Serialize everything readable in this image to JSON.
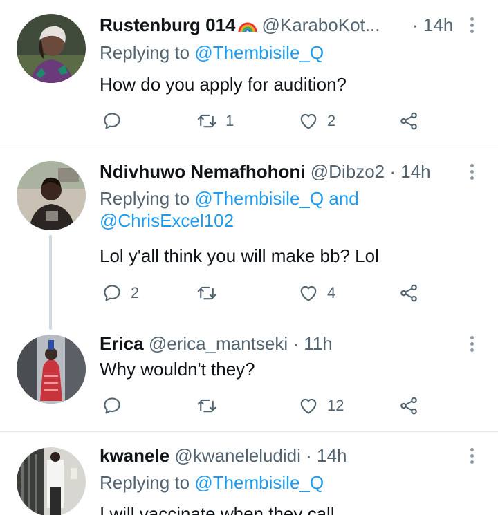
{
  "tweets": [
    {
      "name": "Rustenburg 014",
      "emoji": "rainbow-emoji",
      "handle": "@KaraboKot...",
      "sep": "·",
      "time": "14h",
      "replying_prefix": "Replying to ",
      "replying_to": "@Thembisile_Q",
      "replying_and": "",
      "replying_to2": "",
      "text": "How do you apply for audition?",
      "reply_count": "",
      "retweet_count": "1",
      "like_count": "2"
    },
    {
      "name": "Ndivhuwo Nemafhohoni",
      "handle": "@Dibzo2",
      "sep": "·",
      "time": "14h",
      "replying_prefix": "Replying to ",
      "replying_to": "@Thembisile_Q",
      "replying_and": " and",
      "replying_to2": "@ChrisExcel102",
      "text": "Lol y'all think you will make bb? Lol",
      "reply_count": "2",
      "retweet_count": "",
      "like_count": "4"
    },
    {
      "name": "Erica",
      "handle": "@erica_mantseki",
      "sep": "·",
      "time": "11h",
      "text": "Why wouldn't they?",
      "reply_count": "",
      "retweet_count": "",
      "like_count": "12"
    },
    {
      "name": "kwanele",
      "handle": "@kwaneleludidi",
      "sep": "·",
      "time": "14h",
      "replying_prefix": "Replying to ",
      "replying_to": "@Thembisile_Q",
      "text": "I will vaccinate when they call"
    }
  ],
  "icons": {
    "reply": "reply-icon",
    "retweet": "retweet-icon",
    "like": "heart-icon",
    "share": "share-icon",
    "more": "more-vertical-icon"
  },
  "colors": {
    "link": "#1d9bf0",
    "secondary_text": "#536471",
    "icon": "#536471",
    "divider": "#e1e8ed",
    "thread_line": "#cfd9de"
  }
}
